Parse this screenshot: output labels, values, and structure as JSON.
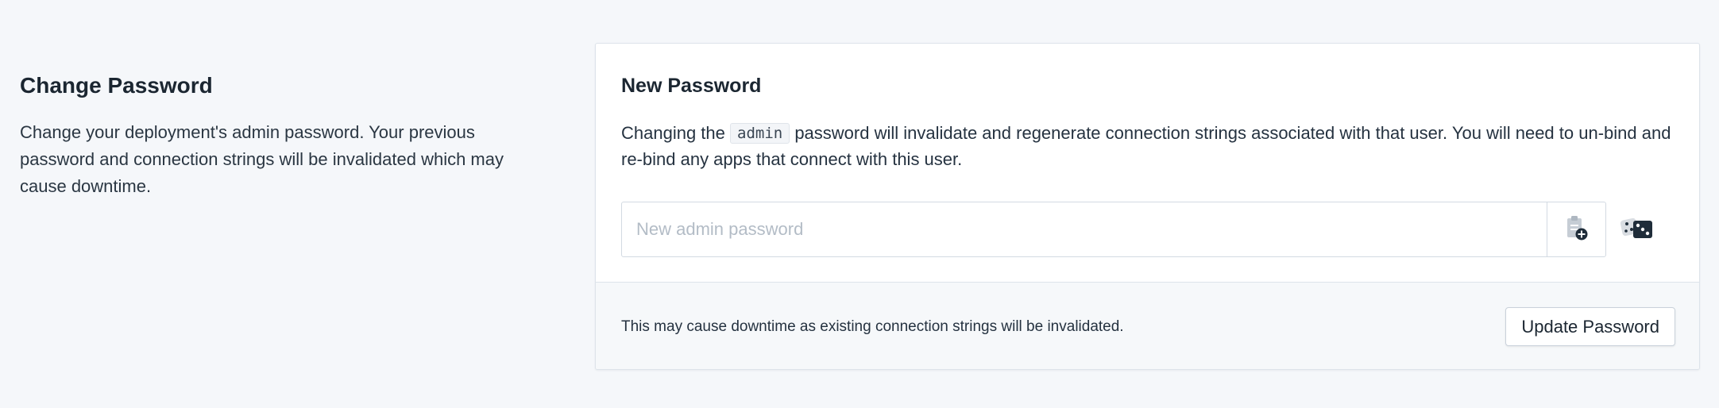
{
  "left": {
    "title": "Change Password",
    "description": "Change your deployment's admin password. Your previous password and connection strings will be invalidated which may cause downtime."
  },
  "card": {
    "title": "New Password",
    "desc_before": "Changing the ",
    "desc_code": "admin",
    "desc_after": " password will invalidate and regenerate connection strings associated with that user. You will need to un-bind and re-bind any apps that connect with this user.",
    "input": {
      "placeholder": "New admin password",
      "value": ""
    },
    "icons": {
      "paste": "clipboard-plus-icon",
      "generate": "dice-icon"
    },
    "footer_note": "This may cause downtime as existing connection strings will be invalidated.",
    "update_label": "Update Password"
  }
}
